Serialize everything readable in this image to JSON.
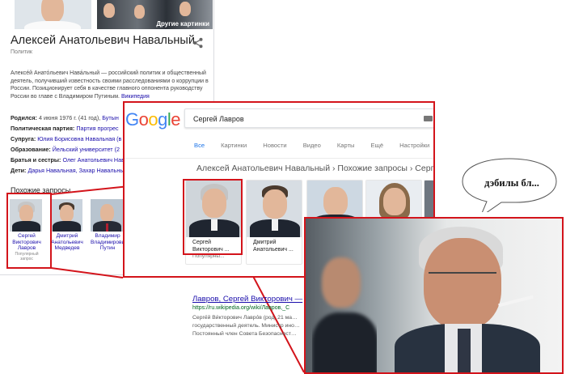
{
  "knowledge_panel": {
    "more_images_label": "Другие картинки",
    "title": "Алексей Анатольевич Навальный",
    "subtitle": "Политик",
    "description": "Алексе́й Анато́льевич Нава́льный — российский политик и общественный деятель, получивший известность своими расследованиями о коррупции в России. Позиционирует себя в качестве главного оппонента руководству России во главе с Владимиром Путиным.",
    "description_link": "Википедия",
    "facts": [
      {
        "label": "Родился:",
        "value": "4 июня 1976 г. (41 год),",
        "link": "Бутын"
      },
      {
        "label": "Политическая партия:",
        "value": "",
        "link": "Партия прогрес"
      },
      {
        "label": "Супруга:",
        "value": "",
        "link": "Юлия Борисовна Навальная (в"
      },
      {
        "label": "Образование:",
        "value": "",
        "link": "Йельский университет (2"
      },
      {
        "label": "Братья и сестры:",
        "value": "",
        "link": "Олег Анатольевич Нав"
      },
      {
        "label": "Дети:",
        "value": "",
        "link": "Дарья Навальная, Захар Навальны"
      }
    ],
    "related_title": "Похожие запросы",
    "related": [
      {
        "name": "Сергей Викторович Лавров",
        "sub": "Популярный запрос"
      },
      {
        "name": "Дмитрий Анатольевич Медведев",
        "sub": ""
      },
      {
        "name": "Владимир Владимирович Путин",
        "sub": ""
      }
    ]
  },
  "google": {
    "logo": [
      "G",
      "o",
      "o",
      "g",
      "l",
      "e"
    ],
    "logo_colors": [
      "#4285f4",
      "#ea4335",
      "#fbbc05",
      "#4285f4",
      "#34a853",
      "#ea4335"
    ],
    "search_value": "Сергей Лавров",
    "tabs": [
      "Все",
      "Картинки",
      "Новости",
      "Видео",
      "Карты",
      "Ещё",
      "Настройки"
    ],
    "active_tab": "Все",
    "breadcrumb": "Алексей Анатольевич Навальный › Похожие запросы › Серге",
    "cards": [
      {
        "name": "Сергей Викторович ...",
        "sub": "Популярны..."
      },
      {
        "name": "Дмитрий Анатольевич ...",
        "sub": ""
      },
      {
        "name": "",
        "sub": ""
      },
      {
        "name": "",
        "sub": ""
      }
    ]
  },
  "result": {
    "title": "Лавров, Сергей Викторович —",
    "url": "https://ru.wikipedia.org/wiki/Лавров,_С",
    "snippet": "Серге́й Ви́кторович Лавро́в (род. 21 ма… государственный деятель. Министр ино… Постоянный член Совета Безопасност…"
  },
  "meme": {
    "bubble_text": "дэбилы бл..."
  },
  "colors": {
    "highlight": "#d3141b",
    "link": "#1a0dab",
    "url": "#006621"
  }
}
